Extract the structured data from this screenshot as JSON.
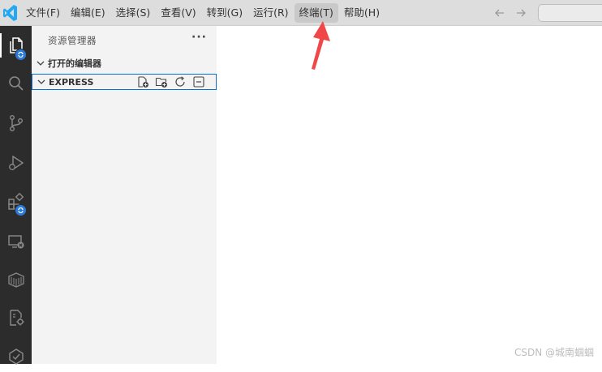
{
  "menu": {
    "items": [
      {
        "label": "文件(F)"
      },
      {
        "label": "编辑(E)"
      },
      {
        "label": "选择(S)"
      },
      {
        "label": "查看(V)"
      },
      {
        "label": "转到(G)"
      },
      {
        "label": "运行(R)"
      },
      {
        "label": "终端(T)",
        "highlighted": true
      },
      {
        "label": "帮助(H)"
      }
    ]
  },
  "activity_bar": {
    "icons": [
      "explorer-icon",
      "search-icon",
      "source-control-icon",
      "run-debug-icon",
      "extensions-icon",
      "remote-explorer-icon",
      "container-icon",
      "package-icon",
      "check-icon"
    ],
    "badge_color": "#2b7bd6"
  },
  "sidebar": {
    "title": "资源管理器",
    "more_label": "···",
    "sections": {
      "open_editors": "打开的编辑器",
      "project": "EXPRESS"
    },
    "project_actions": [
      "new-file-icon",
      "new-folder-icon",
      "refresh-icon",
      "collapse-all-icon"
    ]
  },
  "colors": {
    "accent": "#0a6ed1",
    "annotation": "#f04848",
    "logo": "#23a9f2"
  },
  "watermark": "CSDN @城南蝈蝈"
}
